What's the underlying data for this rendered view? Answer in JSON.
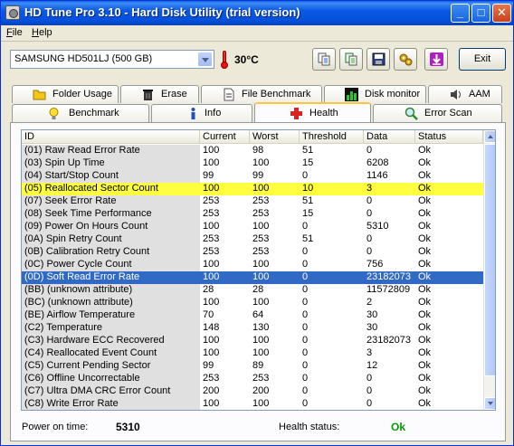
{
  "window": {
    "title": "HD Tune Pro 3.10 - Hard Disk Utility (trial version)",
    "controls": {
      "minimize": "_",
      "maximize": "□",
      "close": "✕"
    }
  },
  "menu": [
    {
      "label": "File",
      "underline": "F"
    },
    {
      "label": "Help",
      "underline": "H"
    }
  ],
  "toolbar": {
    "drive": "SAMSUNG HD501LJ (500 GB)",
    "temperature": "30°C",
    "icon_buttons": [
      "copy-icon",
      "copy-text-icon",
      "save-icon",
      "options-icon",
      "download-icon"
    ],
    "exit_label": "Exit"
  },
  "tabs_row1": [
    {
      "label": "Folder Usage",
      "icon": "folder-icon"
    },
    {
      "label": "Erase",
      "icon": "trash-icon"
    },
    {
      "label": "File Benchmark",
      "icon": "file-benchmark-icon"
    },
    {
      "label": "Disk monitor",
      "icon": "chart-icon"
    },
    {
      "label": "AAM",
      "icon": "speaker-icon"
    }
  ],
  "tabs_row2": [
    {
      "label": "Benchmark",
      "icon": "bulb-icon"
    },
    {
      "label": "Info",
      "icon": "info-icon"
    },
    {
      "label": "Health",
      "icon": "health-cross-icon",
      "active": true
    },
    {
      "label": "Error Scan",
      "icon": "magnifier-icon"
    }
  ],
  "columns": [
    "ID",
    "Current",
    "Worst",
    "Threshold",
    "Data",
    "Status"
  ],
  "rows": [
    {
      "id": "(01) Raw Read Error Rate",
      "current": "100",
      "worst": "98",
      "threshold": "51",
      "data": "0",
      "status": "Ok"
    },
    {
      "id": "(03) Spin Up Time",
      "current": "100",
      "worst": "100",
      "threshold": "15",
      "data": "6208",
      "status": "Ok"
    },
    {
      "id": "(04) Start/Stop Count",
      "current": "99",
      "worst": "99",
      "threshold": "0",
      "data": "1146",
      "status": "Ok"
    },
    {
      "id": "(05) Reallocated Sector Count",
      "current": "100",
      "worst": "100",
      "threshold": "10",
      "data": "3",
      "status": "Ok",
      "highlight": "yellow"
    },
    {
      "id": "(07) Seek Error Rate",
      "current": "253",
      "worst": "253",
      "threshold": "51",
      "data": "0",
      "status": "Ok"
    },
    {
      "id": "(08) Seek Time Performance",
      "current": "253",
      "worst": "253",
      "threshold": "15",
      "data": "0",
      "status": "Ok"
    },
    {
      "id": "(09) Power On Hours Count",
      "current": "100",
      "worst": "100",
      "threshold": "0",
      "data": "5310",
      "status": "Ok"
    },
    {
      "id": "(0A) Spin Retry Count",
      "current": "253",
      "worst": "253",
      "threshold": "51",
      "data": "0",
      "status": "Ok"
    },
    {
      "id": "(0B) Calibration Retry Count",
      "current": "253",
      "worst": "253",
      "threshold": "0",
      "data": "0",
      "status": "Ok"
    },
    {
      "id": "(0C) Power Cycle Count",
      "current": "100",
      "worst": "100",
      "threshold": "0",
      "data": "756",
      "status": "Ok"
    },
    {
      "id": "(0D) Soft Read Error Rate",
      "current": "100",
      "worst": "100",
      "threshold": "0",
      "data": "23182073",
      "status": "Ok",
      "highlight": "blue"
    },
    {
      "id": "(BB) (unknown attribute)",
      "current": "28",
      "worst": "28",
      "threshold": "0",
      "data": "11572809",
      "status": "Ok"
    },
    {
      "id": "(BC) (unknown attribute)",
      "current": "100",
      "worst": "100",
      "threshold": "0",
      "data": "2",
      "status": "Ok"
    },
    {
      "id": "(BE) Airflow Temperature",
      "current": "70",
      "worst": "64",
      "threshold": "0",
      "data": "30",
      "status": "Ok"
    },
    {
      "id": "(C2) Temperature",
      "current": "148",
      "worst": "130",
      "threshold": "0",
      "data": "30",
      "status": "Ok"
    },
    {
      "id": "(C3) Hardware ECC Recovered",
      "current": "100",
      "worst": "100",
      "threshold": "0",
      "data": "23182073",
      "status": "Ok"
    },
    {
      "id": "(C4) Reallocated Event Count",
      "current": "100",
      "worst": "100",
      "threshold": "0",
      "data": "3",
      "status": "Ok"
    },
    {
      "id": "(C5) Current Pending Sector",
      "current": "99",
      "worst": "89",
      "threshold": "0",
      "data": "12",
      "status": "Ok"
    },
    {
      "id": "(C6) Offline Uncorrectable",
      "current": "253",
      "worst": "253",
      "threshold": "0",
      "data": "0",
      "status": "Ok"
    },
    {
      "id": "(C7) Ultra DMA CRC Error Count",
      "current": "200",
      "worst": "200",
      "threshold": "0",
      "data": "0",
      "status": "Ok"
    },
    {
      "id": "(C8) Write Error Rate",
      "current": "100",
      "worst": "100",
      "threshold": "0",
      "data": "0",
      "status": "Ok"
    }
  ],
  "footer": {
    "power_on_label": "Power on time:",
    "power_on_value": "5310",
    "health_label": "Health status:",
    "health_value": "Ok"
  },
  "colors": {
    "title_bar": "#0550DC",
    "highlight_yellow": "#FFFF40",
    "highlight_blue": "#316AC5",
    "health_ok": "#00A000"
  }
}
